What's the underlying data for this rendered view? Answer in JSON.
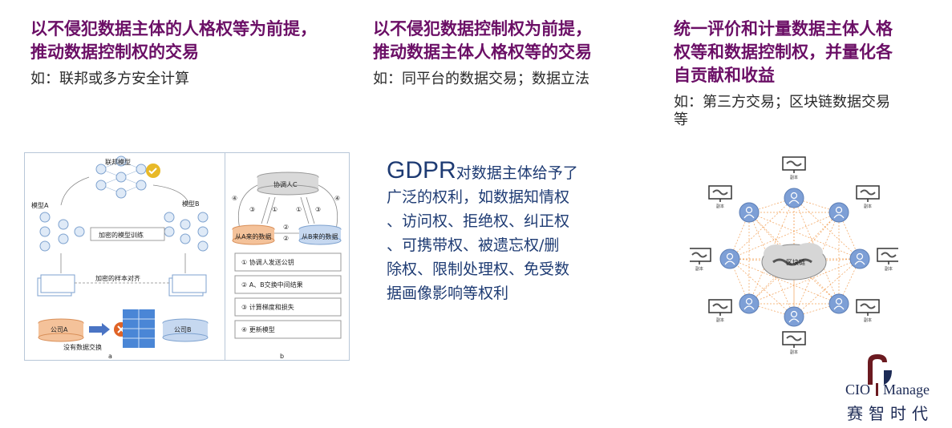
{
  "columns": [
    {
      "headline_lines": [
        "以不侵犯数据主体的人格权等为前提，",
        "推动数据控制权的交易"
      ],
      "example": "如：联邦或多方安全计算"
    },
    {
      "headline_lines": [
        "以不侵犯数据控制权为前提，",
        "推动数据主体人格权等的交易"
      ],
      "example": "如：同平台的数据交易；数据立法"
    },
    {
      "headline_lines": [
        "统一评价和计量数据主体人格",
        "权等和数据控制权，并量化各",
        "自贡献和收益"
      ],
      "example_lines": [
        "如：第三方交易；区块链数据交易",
        "等"
      ]
    }
  ],
  "diagram_a": {
    "federated_model": "联邦模型",
    "model_a": "模型A",
    "model_b": "模型B",
    "encrypted_training": "加密的模型训练",
    "encrypted_alignment": "加密的样本对齐",
    "company_a": "公司A",
    "company_b": "公司B",
    "no_exchange": "没有数据交换",
    "caption": "a"
  },
  "diagram_b": {
    "coordinator": "协调人C",
    "from_a": "从A来的数据",
    "from_b": "从B来的数据",
    "steps": [
      "① 协调人发送公钥",
      "② A、B交换中间结果",
      "③ 计算梯度和损失",
      "④ 更新模型"
    ],
    "marks": [
      "④",
      "③",
      "①",
      "①",
      "③",
      "④",
      "②",
      "②"
    ],
    "caption": "b"
  },
  "gdpr": {
    "lead": "GDPR",
    "lines": [
      "对数据主体给予了",
      "广泛的权利，如数据知情权",
      "、访问权、拒绝权、纠正权",
      "、可携带权、被遗忘权/删",
      "除权、限制处理权、免受数",
      "据画像影响等权利"
    ]
  },
  "blockchain": {
    "center": "区块链",
    "replica": "副本"
  },
  "logo": {
    "line1_left": "CIO",
    "line1_right": "Manage",
    "line2": "赛 智 时 代"
  },
  "colors": {
    "headline": "#6b0f66",
    "gdpr": "#1e3b73",
    "node_blue": "#7d9fd6",
    "edge_orange": "#f2a25a"
  }
}
